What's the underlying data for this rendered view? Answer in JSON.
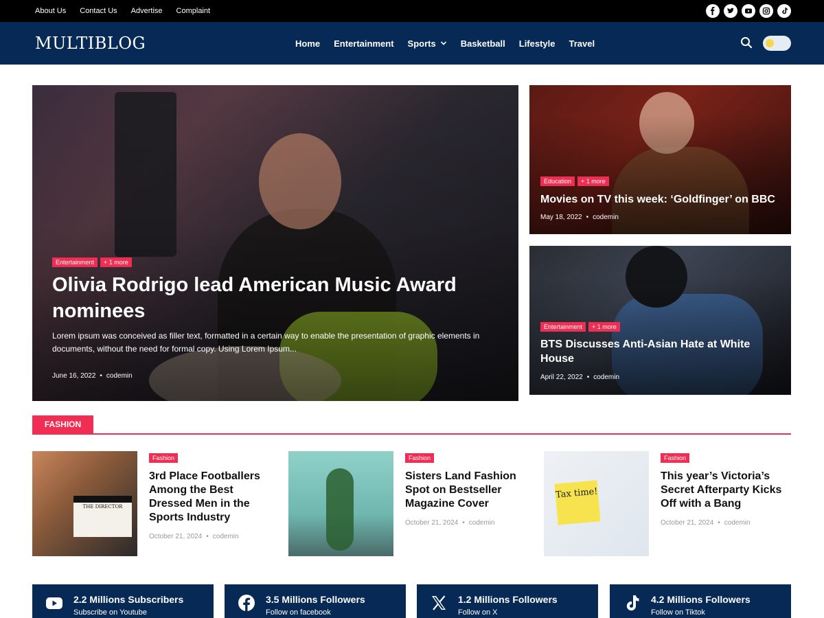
{
  "topbar": {
    "links": [
      "About Us",
      "Contact Us",
      "Advertise",
      "Complaint"
    ],
    "social_icons": [
      "facebook-icon",
      "twitter-icon",
      "youtube-icon",
      "instagram-icon",
      "tiktok-icon"
    ]
  },
  "header": {
    "logo": "MULTIBLOG",
    "nav": [
      "Home",
      "Entertainment",
      "Sports",
      "Basketball",
      "Lifestyle",
      "Travel"
    ],
    "nav_dropdown_item": "Sports"
  },
  "hero": {
    "tags": [
      "Entertainment",
      "+ 1 more"
    ],
    "title": "Olivia Rodrigo lead American Music Award nominees",
    "excerpt": "Lorem ipsum was conceived as filler text, formatted in a certain way to enable the presentation of graphic elements in documents, without the need for formal copy. Using Lorem Ipsum...",
    "date": "June 16, 2022",
    "author": "codemin"
  },
  "side_cards": [
    {
      "tags": [
        "Education",
        "+ 1 more"
      ],
      "title": "Movies on TV this week: ‘Goldfinger’ on BBC",
      "date": "May 18, 2022",
      "author": "codemin"
    },
    {
      "tags": [
        "Entertainment",
        "+ 1 more"
      ],
      "title": "BTS Discusses Anti-Asian Hate at White House",
      "date": "April 22, 2022",
      "author": "codemin"
    }
  ],
  "fashion": {
    "label": "FASHION",
    "items": [
      {
        "tag": "Fashion",
        "title": "3rd Place Footballers Among the Best Dressed Men in the Sports Industry",
        "date": "October 21, 2024",
        "author": "codemin"
      },
      {
        "tag": "Fashion",
        "title": "Sisters Land Fashion Spot on Bestseller Magazine Cover",
        "date": "October 21, 2024",
        "author": "codemin"
      },
      {
        "tag": "Fashion",
        "title": "This year’s Victoria’s Secret Afterparty Kicks Off with a Bang",
        "date": "October 21, 2024",
        "author": "codemin"
      }
    ],
    "thumb_text": {
      "clapper": "THE DIRECTOR",
      "note": "Tax time!"
    }
  },
  "social_tiles": [
    {
      "icon": "youtube-icon",
      "count": "2.2 Millions Subscribers",
      "label": "Subscribe on Youtube"
    },
    {
      "icon": "facebook-icon",
      "count": "3.5 Millions Followers",
      "label": "Follow on facebook"
    },
    {
      "icon": "x-icon",
      "count": "1.2 Millions Followers",
      "label": "Follow on X"
    },
    {
      "icon": "tiktok-icon",
      "count": "4.2 Millions Followers",
      "label": "Follow on Tiktok"
    }
  ],
  "colors": {
    "navy": "#062a55",
    "accent": "#f02d52",
    "topbar": "#000000"
  }
}
